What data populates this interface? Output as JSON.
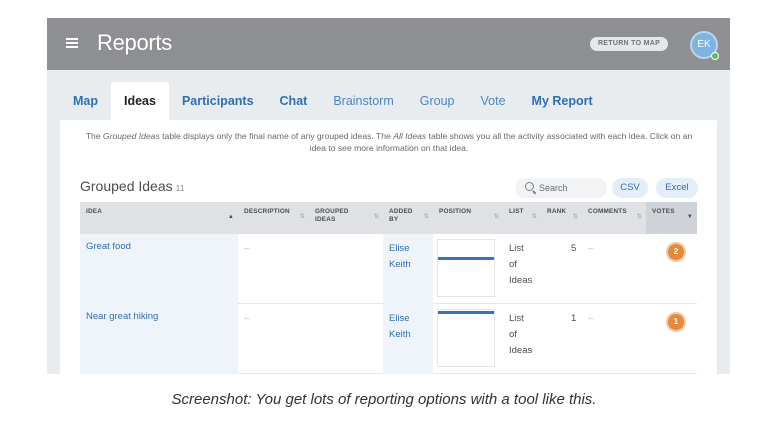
{
  "header": {
    "title": "Reports",
    "return_label": "RETURN TO MAP",
    "avatar_initials": "EK"
  },
  "tabs": [
    {
      "label": "Map",
      "active": false
    },
    {
      "label": "Ideas",
      "active": true
    },
    {
      "label": "Participants",
      "active": false
    },
    {
      "label": "Chat",
      "active": false
    },
    {
      "label": "Brainstorm",
      "active": false
    },
    {
      "label": "Group",
      "active": false
    },
    {
      "label": "Vote",
      "active": false
    },
    {
      "label": "My Report",
      "active": false
    }
  ],
  "intro": {
    "part1": "The ",
    "grouped_ideas_em": "Grouped Ideas",
    "part2": " table displays only the final name of any grouped ideas. The ",
    "all_ideas_em": "All Ideas",
    "part3": " table shows you all the activity associated with each idea. Click on an idea to see more information on that idea."
  },
  "section": {
    "title": "Grouped Ideas",
    "count": "11",
    "search_placeholder": "Search",
    "csv_label": "CSV",
    "excel_label": "Excel"
  },
  "columns": {
    "idea": "IDEA",
    "description": "DESCRIPTION",
    "grouped_1": "GROUPED",
    "grouped_2": "IDEAS",
    "added_1": "ADDED",
    "added_2": "BY",
    "position": "POSITION",
    "list": "LIST",
    "rank": "RANK",
    "comments": "COMMENTS",
    "votes": "VOTES"
  },
  "rows": [
    {
      "idea": "Great food",
      "description": "–",
      "added_first": "Elise",
      "added_last": "Keith",
      "position_fraction": 0.32,
      "list_1": "List",
      "list_2": "of",
      "list_3": "Ideas",
      "rank": "5",
      "comments": "–",
      "votes": "2"
    },
    {
      "idea": "Near great hiking",
      "description": "–",
      "added_first": "Elise",
      "added_last": "Keith",
      "position_fraction": 0.02,
      "list_1": "List",
      "list_2": "of",
      "list_3": "Ideas",
      "rank": "1",
      "comments": "–",
      "votes": "1"
    }
  ],
  "caption": "Screenshot: You get lots of reporting options with a tool like this.",
  "colors": {
    "accent": "#2f6fb5",
    "vote_badge": "#e48a3c",
    "position_bar": "#3b72b5"
  }
}
